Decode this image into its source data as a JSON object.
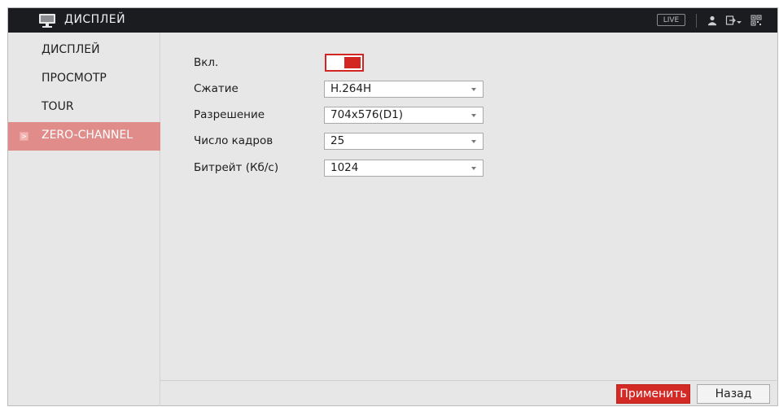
{
  "header": {
    "title": "ДИСПЛЕЙ",
    "icon": "monitor-icon",
    "live_label": "LIVE",
    "right_icons": [
      "user-icon",
      "logout-icon",
      "qr-icon"
    ]
  },
  "sidebar": {
    "items": [
      {
        "label": "ДИСПЛЕЙ",
        "active": false
      },
      {
        "label": "ПРОСМОТР",
        "active": false
      },
      {
        "label": "TOUR",
        "active": false
      },
      {
        "label": "ZERO-CHANNEL",
        "active": true,
        "arrow": ">"
      }
    ]
  },
  "form": {
    "enable_label": "Вкл.",
    "enable_on": true,
    "compression_label": "Сжатие",
    "compression_value": "H.264H",
    "resolution_label": "Разрешение",
    "resolution_value": "704x576(D1)",
    "framerate_label": "Число кадров",
    "framerate_value": "25",
    "bitrate_label": "Битрейт (Кб/с)",
    "bitrate_value": "1024"
  },
  "footer": {
    "apply_label": "Применить",
    "back_label": "Назад"
  },
  "colors": {
    "accent": "#d42a25",
    "sidebar_active": "#e08c8a",
    "topbar": "#1b1c20",
    "panel": "#e7e7e7"
  }
}
